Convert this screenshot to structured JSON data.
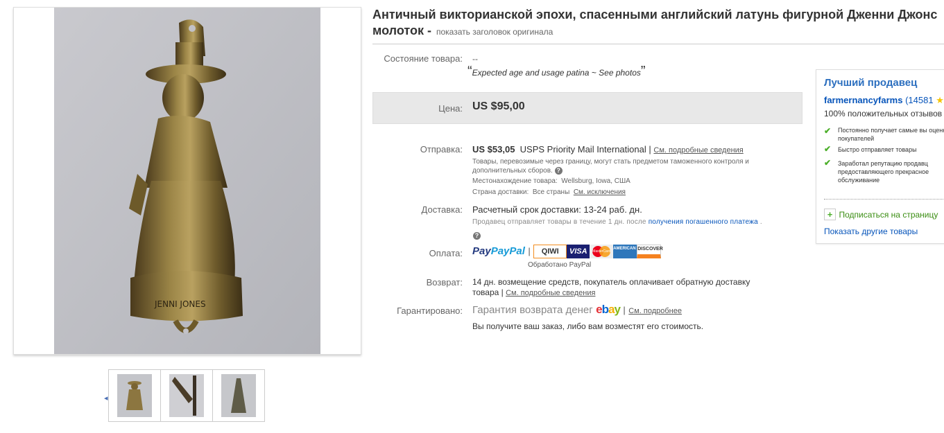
{
  "title": {
    "line1": "Античный викторианской эпохи, спасенными английский латунь фигурной Дженни Джонс",
    "line2": "молоток -",
    "show_original": "показать заголовок оригинала"
  },
  "condition": {
    "label": "Состояние товара:",
    "value": "--",
    "quote": "Expected age and usage patina ~ See photos"
  },
  "price": {
    "label": "Цена:",
    "value": "US $95,00"
  },
  "shipping": {
    "label": "Отправка:",
    "cost": "US $53,05",
    "service": "USPS Priority Mail International",
    "sep": "|",
    "details_link": "См. подробные сведения",
    "customs_note": "Товары, перевозимые через границу, могут стать предметом таможенного контроля и дополнительных сборов.",
    "location_label": "Местонахождение товара:",
    "location": "Wellsburg, Iowa, США",
    "ships_to_label": "Страна доставки:",
    "ships_to": "Все страны",
    "exclusions_link": "См. исключения"
  },
  "delivery": {
    "label": "Доставка:",
    "estimate": "Расчетный срок доставки: 13-24 раб. дн.",
    "handling_prefix": "Продавец отправляет товары в течение 1 дн. после",
    "handling_link": "получения погашенного платежа",
    "handling_suffix": "."
  },
  "payment": {
    "label": "Оплата:",
    "paypal": "PayPal",
    "sep": "|",
    "qiwi": "QIWI",
    "visa": "VISA",
    "mastercard": "MasterCard",
    "amex": "AMERICAN EXPRESS",
    "discover": "DISCOVER",
    "processed_by": "Обработано PayPal"
  },
  "returns": {
    "label": "Возврат:",
    "text1": "14 дн. возмещение средств, покупатель оплачивает обратную доставку",
    "text2": "товара |",
    "details_link": "См. подробные сведения"
  },
  "guarantee": {
    "label": "Гарантировано:",
    "text": "Гарантия возврата денег",
    "brand": [
      "e",
      "b",
      "a",
      "y"
    ],
    "more_link": "См. подробнее",
    "note": "Вы получите ваш заказ, либо вам возместят его стоимость."
  },
  "seller": {
    "heading": "Лучший продавец",
    "name": "farmernancyfarms",
    "score": "(14581",
    "positive": "100% положительных отзывов",
    "points": [
      "Постоянно получает самые вы оценки покупателей",
      "Быстро отправляет товары",
      "Заработал репутацию продавц предоставляющего прекрасное обслуживание"
    ],
    "subscribe": "Подписаться на страницу",
    "other_items": "Показать другие товары"
  },
  "colors": {
    "link": "#0654ba",
    "seller_heading": "#2c6fbf",
    "check": "#4caf2a",
    "price_bar": "#e8e8e8",
    "ebay_e": "#e53238",
    "ebay_b": "#0064d2",
    "ebay_a": "#f5af02",
    "ebay_y": "#86b817"
  }
}
